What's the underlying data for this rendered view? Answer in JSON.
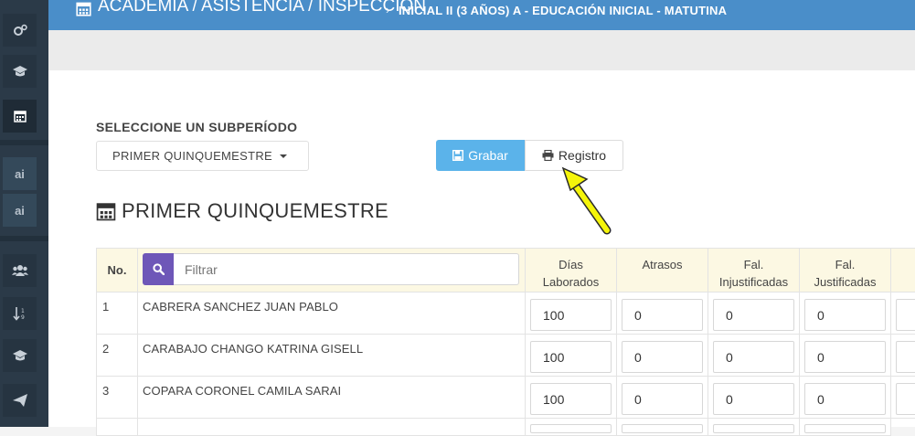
{
  "header": {
    "breadcrumb": "ACADEMIA / ASISTENCIA / INSPECCIÓN",
    "subtitle": "INICIAL II (3 AÑOS) A - EDUCACIÓN INICIAL - MATUTINA"
  },
  "sidebar": {
    "items": [
      {
        "icon": "gears-icon"
      },
      {
        "icon": "graduation-cap-icon"
      },
      {
        "icon": "calendar-icon"
      },
      {
        "icon": "ai-label",
        "label": "ai"
      },
      {
        "icon": "ai-label",
        "label": "ai"
      },
      {
        "icon": "users-icon"
      },
      {
        "icon": "sort-numeric-icon"
      },
      {
        "icon": "graduation-cap-icon"
      },
      {
        "icon": "paper-plane-icon"
      }
    ]
  },
  "subperiod": {
    "label": "SELECCIONE UN SUBPERÍODO",
    "selected": "PRIMER QUINQUEMESTRE"
  },
  "buttons": {
    "grabar": "Grabar",
    "registro": "Registro"
  },
  "section_title": "PRIMER QUINQUEMESTRE",
  "table": {
    "headers": {
      "no": "No.",
      "filter_placeholder": "Filtrar",
      "dias_laborados": "Días Laborados",
      "atrasos": "Atrasos",
      "fal_injustificadas": "Fal. Injustificadas",
      "fal_justificadas": "Fal. Justificadas"
    },
    "rows": [
      {
        "no": "1",
        "name": "CABRERA SANCHEZ JUAN PABLO",
        "dias": "100",
        "atrasos": "0",
        "fal_inj": "0",
        "fal_just": "0"
      },
      {
        "no": "2",
        "name": "CARABAJO CHANGO KATRINA GISELL",
        "dias": "100",
        "atrasos": "0",
        "fal_inj": "0",
        "fal_just": "0"
      },
      {
        "no": "3",
        "name": "COPARA CORONEL CAMILA SARAI",
        "dias": "100",
        "atrasos": "0",
        "fal_inj": "0",
        "fal_just": "0"
      }
    ]
  },
  "colors": {
    "header_bg": "#4a8ec9",
    "sidebar_bg": "#2b3a48",
    "grabar_bg": "#5bb3ea",
    "search_btn_bg": "#6e57b8",
    "table_header_bg": "#fcf8e3",
    "arrow": "#f5f50a"
  }
}
